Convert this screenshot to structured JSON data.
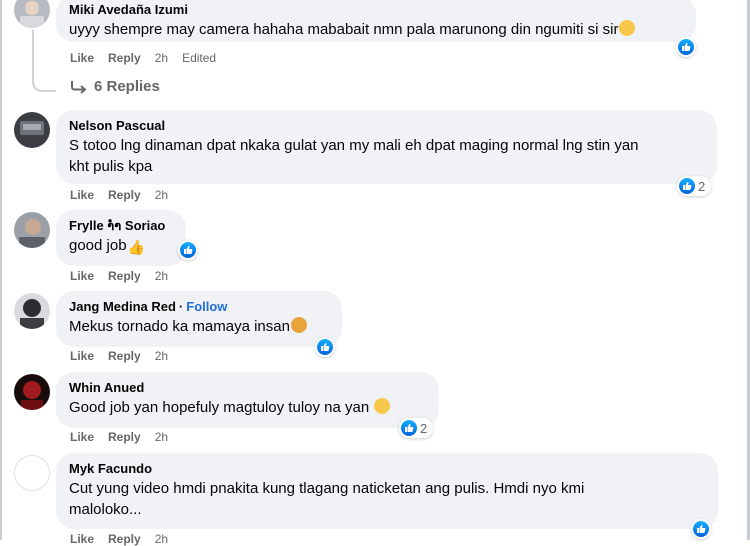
{
  "comments": [
    {
      "author": "Miki Avedaña Izumi",
      "text": "uyyy shempre may camera hahaha mababait nmn pala marunong din ngumiti si sir",
      "like": "Like",
      "reply": "Reply",
      "time": "2h",
      "edited": "Edited",
      "reaction_emoji": "grin-sweat-emoji"
    },
    {
      "author": "Nelson Pascual",
      "text_line1": "S totoo lng dinaman dpat nkaka gulat yan my mali eh dpat maging normal lng stin yan",
      "text_line2": "kht pulis kpa",
      "like": "Like",
      "reply": "Reply",
      "time": "2h",
      "reaction_count": "2"
    },
    {
      "author": "Frylle າໍຳ Soriao",
      "text": "good job",
      "like": "Like",
      "reply": "Reply",
      "time": "2h",
      "reaction_emoji": "thumbs-up-emoji"
    },
    {
      "author": "Jang Medina Red",
      "follow": "Follow",
      "text": "Mekus tornado ka mamaya insan",
      "like": "Like",
      "reply": "Reply",
      "time": "2h",
      "reaction_emoji": "hug-emoji"
    },
    {
      "author": "Whin Anued",
      "text": "Good job yan hopefuly magtuloy tuloy na yan",
      "like": "Like",
      "reply": "Reply",
      "time": "2h",
      "reaction_count": "2",
      "reaction_emoji": "grin-emoji"
    },
    {
      "author": "Myk Facundo",
      "text_line1": "Cut yung video hmdi pnakita kung tlagang naticketan ang pulis. Hmdi nyo kmi",
      "text_line2": "maloloko...",
      "like": "Like",
      "reply": "Reply",
      "time": "2h"
    }
  ],
  "replies_link": "6 Replies",
  "colors": {
    "bubble": "#f0f2f5",
    "like_blue": "#0a7cff",
    "muted": "#65676b",
    "follow": "#216fdb"
  }
}
